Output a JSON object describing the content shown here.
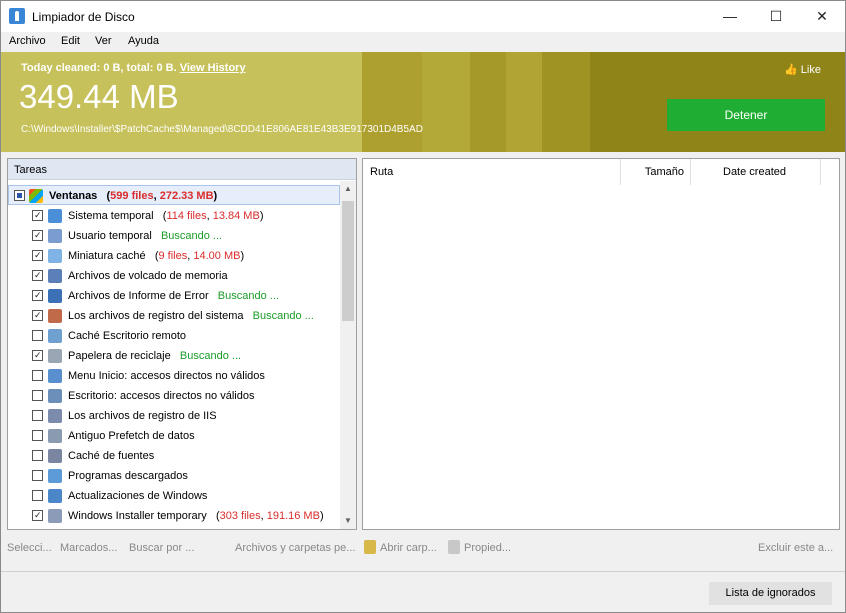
{
  "window": {
    "title": "Limpiador de Disco",
    "minimize": "—",
    "maximize": "☐",
    "close": "✕"
  },
  "menu": [
    "Archivo",
    "Edit",
    "Ver",
    "Ayuda"
  ],
  "banner": {
    "summary": "Today cleaned: 0 B, total: 0 B.",
    "view_history": "View History",
    "size": "349.44 MB",
    "path": "C:\\Windows\\Installer\\$PatchCache$\\Managed\\8CDD41E806AE81E43B3E917301D4B5AD",
    "like": "Like",
    "stop_button": "Detener",
    "colors": {
      "stop": "#1fae33"
    }
  },
  "tasks": {
    "header": "Tareas",
    "group": {
      "name": "Ventanas",
      "open": "(",
      "files": "599 files",
      "sep": ", ",
      "size": "272.33 MB",
      "close": ")"
    },
    "items": [
      {
        "label": "Sistema temporal",
        "checked": true,
        "open": "(",
        "files": "114 files",
        "sep": ", ",
        "size": "13.84 MB",
        "close": ")",
        "status": ""
      },
      {
        "label": "Usuario temporal",
        "checked": true,
        "status": "Buscando ..."
      },
      {
        "label": "Miniatura caché",
        "checked": true,
        "open": "(",
        "files": "9 files",
        "sep": ", ",
        "size": "14.00 MB",
        "close": ")",
        "status": ""
      },
      {
        "label": "Archivos de volcado de memoria",
        "checked": true,
        "status": ""
      },
      {
        "label": "Archivos de Informe de Error",
        "checked": true,
        "status": "Buscando ..."
      },
      {
        "label": "Los archivos de registro del sistema",
        "checked": true,
        "status": "Buscando ..."
      },
      {
        "label": "Caché Escritorio remoto",
        "checked": false,
        "status": ""
      },
      {
        "label": "Papelera de reciclaje",
        "checked": true,
        "status": "Buscando ..."
      },
      {
        "label": "Menu Inicio: accesos directos no válidos",
        "checked": false,
        "status": ""
      },
      {
        "label": "Escritorio: accesos directos no válidos",
        "checked": false,
        "status": ""
      },
      {
        "label": "Los archivos de registro de IIS",
        "checked": false,
        "status": ""
      },
      {
        "label": "Antiguo Prefetch de datos",
        "checked": false,
        "status": ""
      },
      {
        "label": "Caché de fuentes",
        "checked": false,
        "status": ""
      },
      {
        "label": "Programas descargados",
        "checked": false,
        "status": ""
      },
      {
        "label": "Actualizaciones de Windows",
        "checked": false,
        "status": ""
      },
      {
        "label": "Windows Installer temporary",
        "checked": true,
        "open": "(",
        "files": "303 files",
        "sep": ", ",
        "size": "191.16 MB",
        "close": ")",
        "status": ""
      }
    ]
  },
  "results": {
    "columns": [
      "Ruta",
      "Tamaño",
      "Date created"
    ]
  },
  "toolbar": {
    "select": "Selecci...",
    "marked": "Marcados...",
    "search": "Buscar por ...",
    "files_folders": "Archivos y carpetas pe...",
    "open_folder": "Abrir carp...",
    "properties": "Propied...",
    "exclude": "Excluir este a..."
  },
  "ignored_button": "Lista de ignorados"
}
